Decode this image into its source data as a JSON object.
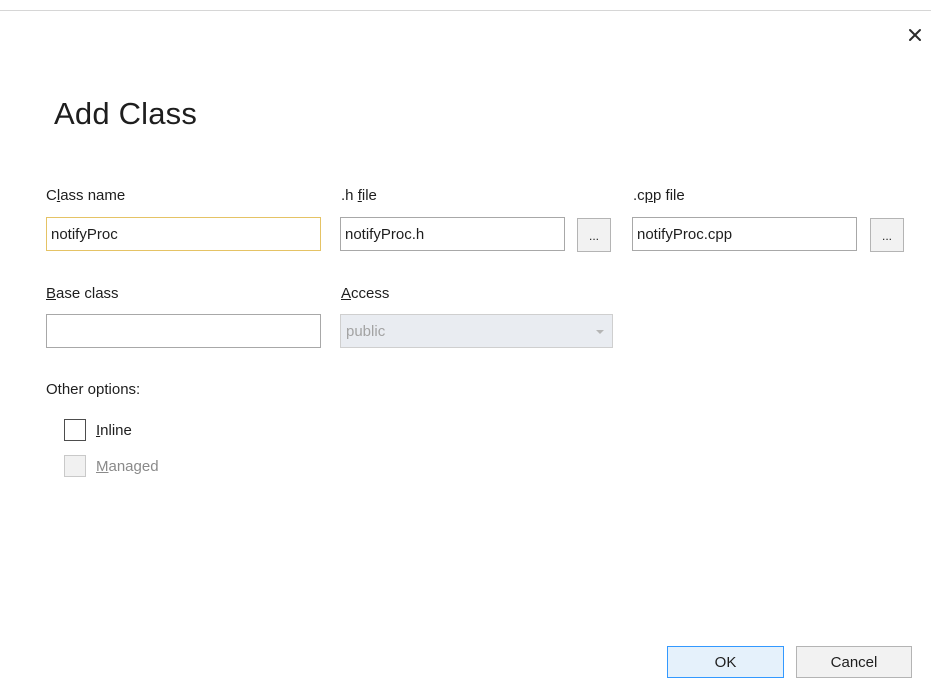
{
  "dialog": {
    "title": "Add Class",
    "close_glyph": "✕"
  },
  "class_name": {
    "label_pre": "C",
    "label_key": "l",
    "label_post": "ass name",
    "value": "notifyProc"
  },
  "h_file": {
    "label_pre": ".h ",
    "label_key": "f",
    "label_post": "ile",
    "value": "notifyProc.h",
    "browse_label": "..."
  },
  "cpp_file": {
    "label_pre": ".c",
    "label_key": "p",
    "label_post": "p file",
    "value": "notifyProc.cpp",
    "browse_label": "..."
  },
  "base_class": {
    "label_pre": "",
    "label_key": "B",
    "label_post": "ase class",
    "value": ""
  },
  "access": {
    "label_pre": "",
    "label_key": "A",
    "label_post": "ccess",
    "value": "public"
  },
  "other_options": {
    "label": "Other options:",
    "inline": {
      "label_pre": "",
      "label_key": "I",
      "label_post": "nline",
      "checked": false
    },
    "managed": {
      "label_pre": "",
      "label_key": "M",
      "label_post": "anaged",
      "checked": false,
      "disabled": true
    }
  },
  "buttons": {
    "ok": "OK",
    "cancel": "Cancel"
  },
  "colors": {
    "focus_border": "#e5c365",
    "ok_border": "#3399ff",
    "disabled_bg": "#e9ecf1"
  }
}
